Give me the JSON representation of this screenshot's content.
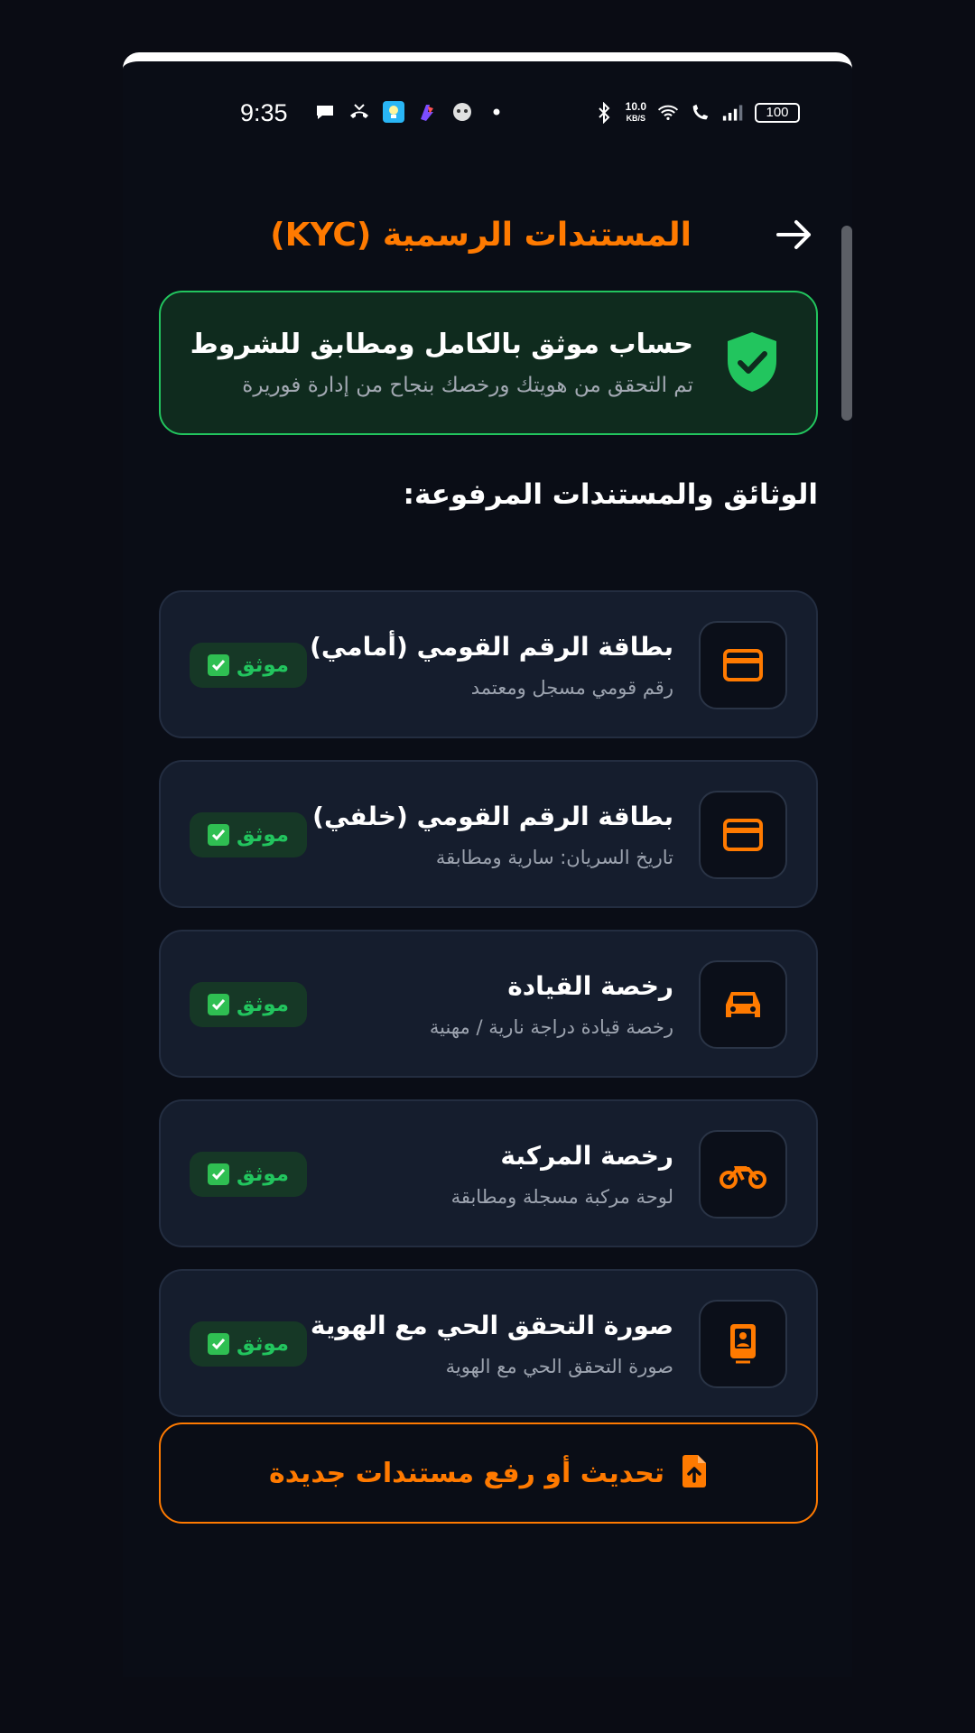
{
  "status_bar": {
    "time": "9:35",
    "network_speed_value": "10.0",
    "network_speed_unit": "KB/S",
    "battery": "100"
  },
  "header": {
    "title": "المستندات الرسمية (KYC)",
    "back_icon": "arrow-right-icon"
  },
  "verification_banner": {
    "title": "حساب موثق بالكامل ومطابق للشروط",
    "subtitle": "تم التحقق من هويتك ورخصك بنجاح من إدارة فوريرة",
    "icon": "shield-check-icon"
  },
  "section_title": "الوثائق والمستندات المرفوعة:",
  "documents": [
    {
      "title": "بطاقة الرقم القومي (أمامي)",
      "subtitle": "رقم قومي مسجل ومعتمد",
      "icon": "id-card-icon",
      "status": "موثق"
    },
    {
      "title": "بطاقة الرقم القومي (خلفي)",
      "subtitle": "تاريخ السريان: سارية ومطابقة",
      "icon": "id-card-icon",
      "status": "موثق"
    },
    {
      "title": "رخصة القيادة",
      "subtitle": "رخصة قيادة دراجة نارية / مهنية",
      "icon": "car-icon",
      "status": "موثق"
    },
    {
      "title": "رخصة المركبة",
      "subtitle": "لوحة مركبة مسجلة ومطابقة",
      "icon": "motorcycle-icon",
      "status": "موثق"
    },
    {
      "title": "صورة التحقق الحي مع الهوية",
      "subtitle": "صورة التحقق الحي مع الهوية",
      "icon": "selfie-id-icon",
      "status": "موثق"
    }
  ],
  "upload_button": {
    "label": "تحديث أو رفع مستندات جديدة",
    "icon": "file-upload-icon"
  },
  "colors": {
    "accent": "#ff7a00",
    "success": "#22c55e",
    "background": "#0a0d16",
    "card": "#151d2d"
  }
}
